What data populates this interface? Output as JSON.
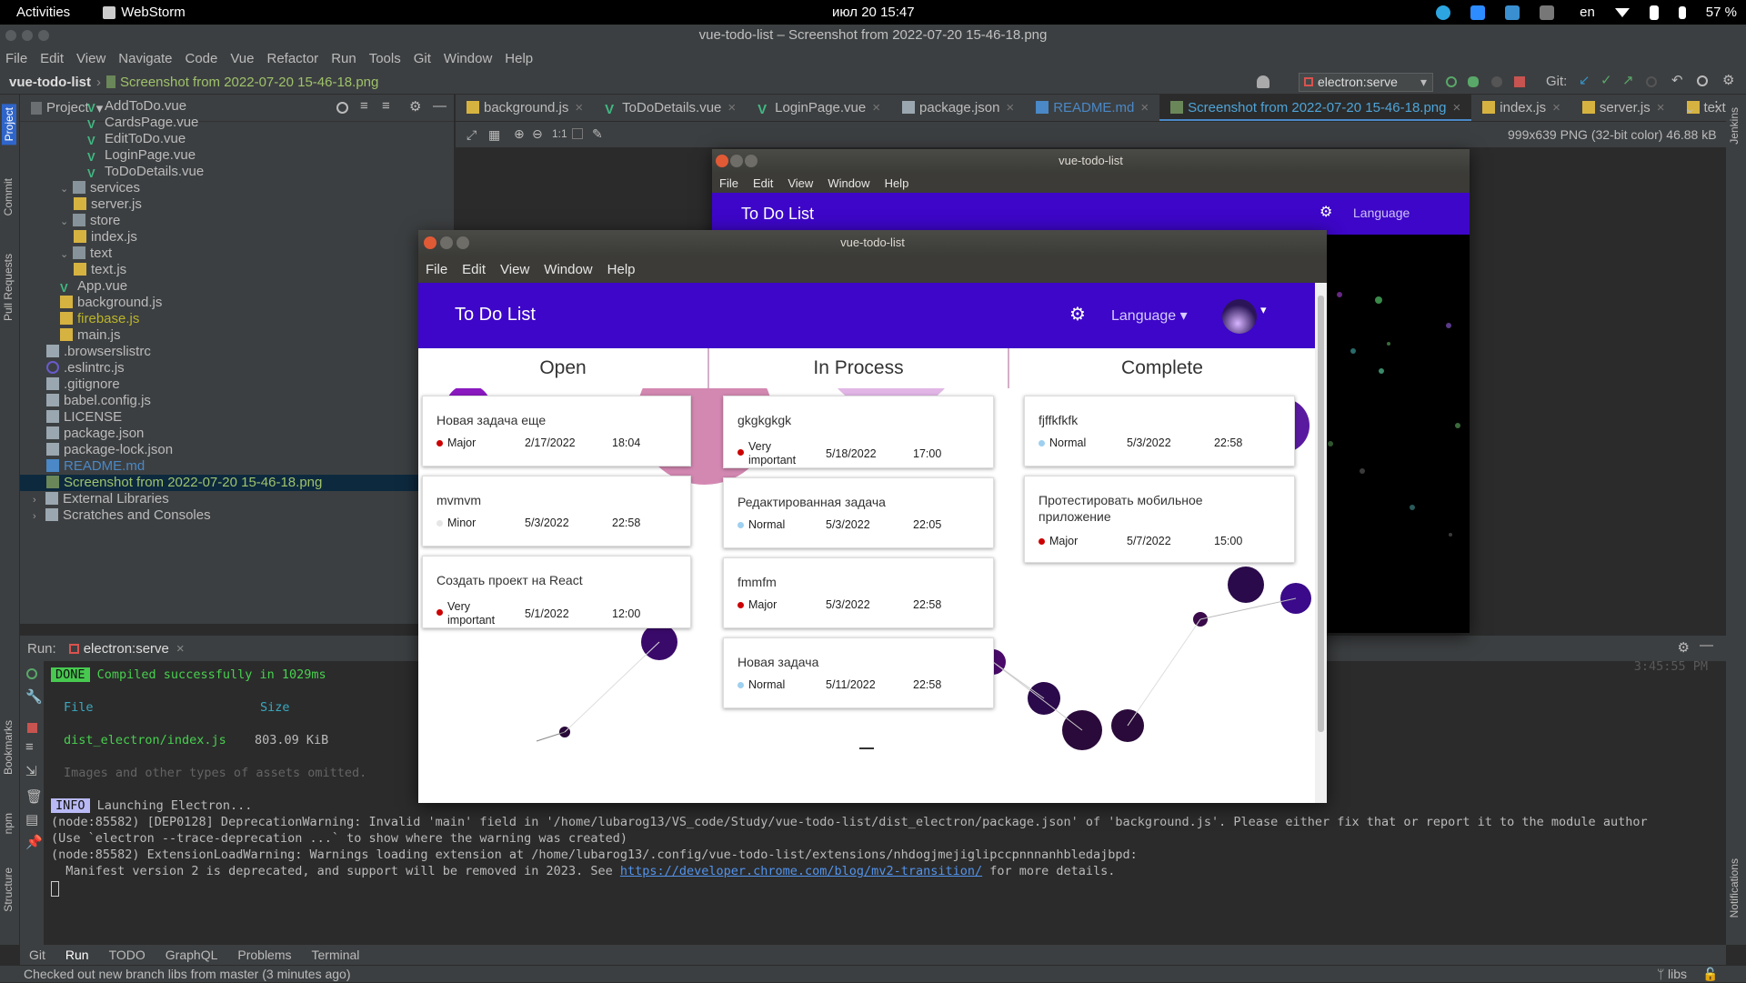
{
  "gnome": {
    "activities": "Activities",
    "app": "WebStorm",
    "clock": "июл 20  15:47",
    "lang": "en",
    "battery": "57 %"
  },
  "window_title": "vue-todo-list – Screenshot from 2022-07-20 15-46-18.png",
  "menu": [
    "File",
    "Edit",
    "View",
    "Navigate",
    "Code",
    "Vue",
    "Refactor",
    "Run",
    "Tools",
    "Git",
    "Window",
    "Help"
  ],
  "breadcrumb": {
    "project": "vue-todo-list",
    "file": "Screenshot from 2022-07-20 15-46-18.png"
  },
  "run_config": "electron:serve",
  "git_label": "Git:",
  "stripes": {
    "project": "Project",
    "commit": "Commit",
    "pull": "Pull Requests",
    "bookmarks": "Bookmarks",
    "npm": "npm",
    "structure": "Structure",
    "notifications": "Notifications",
    "jenkins": "Jenkins"
  },
  "project_panel": {
    "title": "Project",
    "tree": [
      {
        "label": "AddToDo.vue",
        "kind": "vue",
        "indent": 4
      },
      {
        "label": "CardsPage.vue",
        "kind": "vue",
        "indent": 4
      },
      {
        "label": "EditToDo.vue",
        "kind": "vue",
        "indent": 4
      },
      {
        "label": "LoginPage.vue",
        "kind": "vue",
        "indent": 4
      },
      {
        "label": "ToDoDetails.vue",
        "kind": "vue",
        "indent": 4
      },
      {
        "label": "services",
        "kind": "folder",
        "indent": 2
      },
      {
        "label": "server.js",
        "kind": "js",
        "indent": 3
      },
      {
        "label": "store",
        "kind": "folder",
        "indent": 2
      },
      {
        "label": "index.js",
        "kind": "js",
        "indent": 3
      },
      {
        "label": "text",
        "kind": "folder",
        "indent": 2
      },
      {
        "label": "text.js",
        "kind": "js",
        "indent": 3
      },
      {
        "label": "App.vue",
        "kind": "vue",
        "indent": 2
      },
      {
        "label": "background.js",
        "kind": "js",
        "indent": 2
      },
      {
        "label": "firebase.js",
        "kind": "js-warn",
        "indent": 2
      },
      {
        "label": "main.js",
        "kind": "js",
        "indent": 2
      },
      {
        "label": ".browserslistrc",
        "kind": "file",
        "indent": 1
      },
      {
        "label": ".eslintrc.js",
        "kind": "eslint",
        "indent": 1
      },
      {
        "label": ".gitignore",
        "kind": "file",
        "indent": 1
      },
      {
        "label": "babel.config.js",
        "kind": "file",
        "indent": 1
      },
      {
        "label": "LICENSE",
        "kind": "file",
        "indent": 1
      },
      {
        "label": "package.json",
        "kind": "file",
        "indent": 1
      },
      {
        "label": "package-lock.json",
        "kind": "file",
        "indent": 1
      },
      {
        "label": "README.md",
        "kind": "md",
        "indent": 1
      },
      {
        "label": "Screenshot from 2022-07-20 15-46-18.png",
        "kind": "png",
        "indent": 1,
        "selected": true
      },
      {
        "label": "External Libraries",
        "kind": "lib",
        "indent": 0
      },
      {
        "label": "Scratches and Consoles",
        "kind": "scratch",
        "indent": 0
      }
    ]
  },
  "tabs": [
    {
      "label": "background.js",
      "kind": "js"
    },
    {
      "label": "ToDoDetails.vue",
      "kind": "vue"
    },
    {
      "label": "LoginPage.vue",
      "kind": "vue"
    },
    {
      "label": "package.json",
      "kind": "file"
    },
    {
      "label": "README.md",
      "kind": "md"
    },
    {
      "label": "Screenshot from 2022-07-20 15-46-18.png",
      "kind": "png",
      "active": true
    },
    {
      "label": "index.js",
      "kind": "js"
    },
    {
      "label": "server.js",
      "kind": "js"
    },
    {
      "label": "text.js",
      "kind": "js"
    }
  ],
  "image_info": "999x639 PNG (32-bit color) 46.88 kB",
  "zoom_label": "1:1",
  "run_panel": {
    "label": "Run:",
    "config": "electron:serve",
    "time": "3:45:55 PM"
  },
  "console": {
    "done_badge": "DONE",
    "done_text": "Compiled successfully in 1029ms",
    "file_header": "File",
    "size_header": "Size",
    "file_row": "dist_electron/index.js",
    "file_size": "803.09 KiB",
    "omitted": "Images and other types of assets omitted.",
    "info_badge": "INFO",
    "info_text": "Launching Electron...",
    "lines": [
      "(node:85582) [DEP0128] DeprecationWarning: Invalid 'main' field in '/home/lubarog13/VS_code/Study/vue-todo-list/dist_electron/package.json' of 'background.js'. Please either fix that or report it to the module author",
      "(Use `electron --trace-deprecation ...` to show where the warning was created)",
      "(node:85582) ExtensionLoadWarning: Warnings loading extension at /home/lubarog13/.config/vue-todo-list/extensions/nhdogjmejiglipccpnnnanhbledajbpd:"
    ],
    "manifest_pre": "  Manifest version 2 is deprecated, and support will be removed in 2023. See ",
    "manifest_link": "https://developer.chrome.com/blog/mv2-transition/",
    "manifest_post": " for more details."
  },
  "bottom_tabs": [
    "Git",
    "Run",
    "TODO",
    "GraphQL",
    "Problems",
    "Terminal"
  ],
  "status": {
    "text": "Checked out new branch libs from master (3 minutes ago)",
    "branch": "libs"
  },
  "back_app": {
    "title": "vue-todo-list",
    "menu": [
      "File",
      "Edit",
      "View",
      "Window",
      "Help"
    ],
    "brand": "To Do List",
    "language": "Language"
  },
  "app": {
    "title": "vue-todo-list",
    "menu": [
      "File",
      "Edit",
      "View",
      "Window",
      "Help"
    ],
    "brand": "To Do List",
    "language": "Language",
    "columns": [
      {
        "title": "Open",
        "cards": [
          {
            "title": "Новая задача еще",
            "priority": "Major",
            "color": "#cc0000",
            "date": "2/17/2022",
            "time": "18:04"
          },
          {
            "title": "mvmvm",
            "priority": "Minor",
            "color": "#e6e6e6",
            "date": "5/3/2022",
            "time": "22:58"
          },
          {
            "title": "Создать проект на React",
            "priority": "Very important",
            "color": "#cc0000",
            "date": "5/1/2022",
            "time": "12:00"
          }
        ]
      },
      {
        "title": "In Process",
        "cards": [
          {
            "title": "gkgkgkgk",
            "priority": "Very important",
            "color": "#cc0000",
            "date": "5/18/2022",
            "time": "17:00"
          },
          {
            "title": "Редактированная задача",
            "priority": "Normal",
            "color": "#9ed0f0",
            "date": "5/3/2022",
            "time": "22:05"
          },
          {
            "title": "fmmfm",
            "priority": "Major",
            "color": "#cc0000",
            "date": "5/3/2022",
            "time": "22:58"
          },
          {
            "title": "Новая задача",
            "priority": "Normal",
            "color": "#9ed0f0",
            "date": "5/11/2022",
            "time": "22:58"
          }
        ]
      },
      {
        "title": "Complete",
        "cards": [
          {
            "title": "fjffkfkfk",
            "priority": "Normal",
            "color": "#9ed0f0",
            "date": "5/3/2022",
            "time": "22:58"
          },
          {
            "title": "Протестировать мобильное приложение",
            "priority": "Major",
            "color": "#cc0000",
            "date": "5/7/2022",
            "time": "15:00"
          }
        ]
      }
    ]
  }
}
